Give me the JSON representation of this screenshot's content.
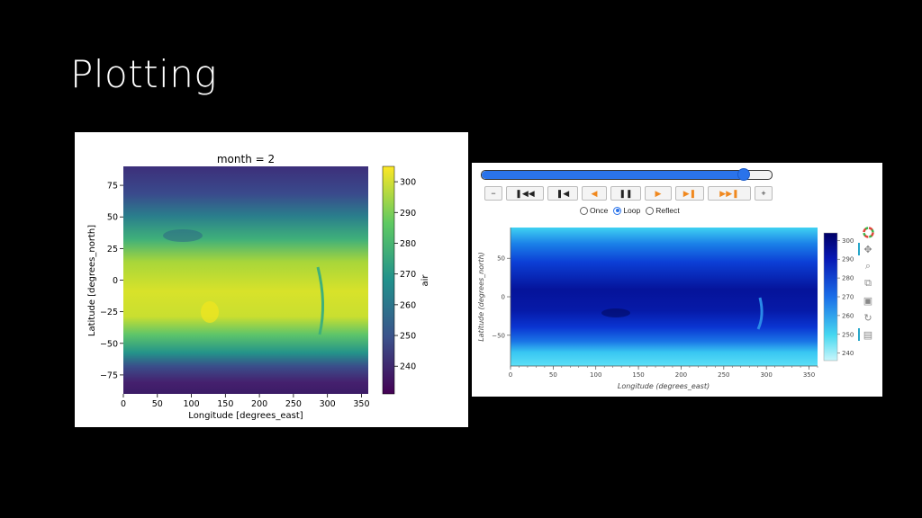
{
  "slide": {
    "title": "Plotting"
  },
  "left_plot": {
    "title": "month = 2",
    "xlabel": "Longitude [degrees_east]",
    "ylabel": "Latitude [degrees_north]",
    "xticks": [
      "0",
      "50",
      "100",
      "150",
      "200",
      "250",
      "300",
      "350"
    ],
    "yticks": [
      "75",
      "50",
      "25",
      "0",
      "−25",
      "−50",
      "−75"
    ],
    "colorbar_label": "air",
    "colorbar_ticks": [
      "300",
      "290",
      "280",
      "270",
      "260",
      "250",
      "240"
    ],
    "colormap": "viridis"
  },
  "right_plot": {
    "player": {
      "buttons": [
        "−",
        "❚◀◀",
        "❚◀",
        "◀",
        "❚❚",
        "▶",
        "▶❚",
        "▶▶❚",
        "+"
      ],
      "slider_fraction": 0.9,
      "radios": [
        {
          "label": "Once",
          "checked": false
        },
        {
          "label": "Loop",
          "checked": true
        },
        {
          "label": "Reflect",
          "checked": false
        }
      ]
    },
    "xlabel": "Longitude (degrees_east)",
    "ylabel": "Latitude (degrees_north)",
    "xticks": [
      "0",
      "50",
      "100",
      "150",
      "200",
      "250",
      "300",
      "350"
    ],
    "yticks": [
      "50",
      "0",
      "−50"
    ],
    "colorbar_ticks": [
      "300",
      "290",
      "280",
      "270",
      "260",
      "250",
      "240"
    ],
    "colormap": "blues (dark blue high, cyan low)",
    "tools": [
      "bokeh-logo-icon",
      "pan-icon",
      "zoom-icon",
      "box-zoom-icon",
      "save-icon",
      "reset-icon",
      "hover-icon"
    ]
  }
}
